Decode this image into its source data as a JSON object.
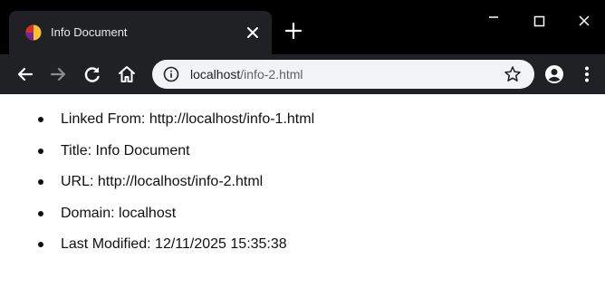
{
  "browser": {
    "tab": {
      "title": "Info Document",
      "favicon": "pie-chart-icon",
      "close_icon": "close-icon"
    },
    "new_tab_icon": "plus-icon",
    "window_controls": [
      "minimize-icon",
      "maximize-icon",
      "close-icon"
    ],
    "toolbar": {
      "back_icon": "arrow-left-icon",
      "forward_icon": "arrow-right-icon",
      "reload_icon": "reload-icon",
      "home_icon": "home-icon",
      "profile_icon": "account-icon",
      "menu_icon": "kebab-menu-icon"
    },
    "address_bar": {
      "info_icon": "info-icon",
      "host": "localhost",
      "path": "/info-2.html",
      "bookmark_icon": "star-icon"
    }
  },
  "page": {
    "items": [
      "Linked From: http://localhost/info-1.html",
      "Title: Info Document",
      "URL: http://localhost/info-2.html",
      "Domain: localhost",
      "Last Modified: 12/11/2025 15:35:38"
    ]
  },
  "colors": {
    "titlebar": "#000000",
    "tab_and_toolbar": "#202124",
    "omnibox": "#f1f3f4",
    "favicon_yellow": "#fbc02d",
    "favicon_red": "#d32f2f",
    "page_background": "#ffffff"
  }
}
